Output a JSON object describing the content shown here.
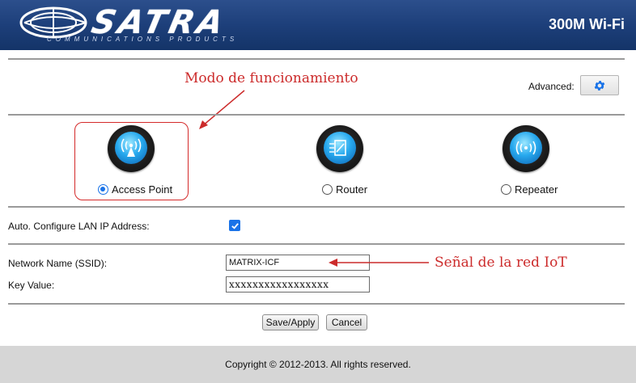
{
  "header": {
    "logo_text": "SATRA",
    "logo_subtitle": "COMMUNICATIONS PRODUCTS",
    "model": "300M Wi-Fi",
    "colors": {
      "header_bg": "#1d3f7a",
      "accent": "#1a73e8",
      "annotation": "#cc2b2b"
    }
  },
  "annotations": {
    "mode_label": "Modo de funcionamiento",
    "ssid_label": "Señal de la red IoT"
  },
  "advanced": {
    "label": "Advanced:",
    "icon": "gear-icon"
  },
  "modes": [
    {
      "label": "Access Point",
      "icon": "access-point-icon",
      "selected": true
    },
    {
      "label": "Router",
      "icon": "router-icon",
      "selected": false
    },
    {
      "label": "Repeater",
      "icon": "repeater-icon",
      "selected": false
    }
  ],
  "lan": {
    "label": "Auto. Configure LAN IP Address:",
    "checked": true
  },
  "wifi": {
    "ssid_label": "Network Name (SSID):",
    "ssid_value": "MATRIX-ICF",
    "key_label": "Key Value:",
    "key_value": "xxxxxxxxxxxxxxxxx"
  },
  "actions": {
    "save": "Save/Apply",
    "cancel": "Cancel"
  },
  "footer": {
    "copyright": "Copyright © 2012-2013. All rights reserved."
  }
}
